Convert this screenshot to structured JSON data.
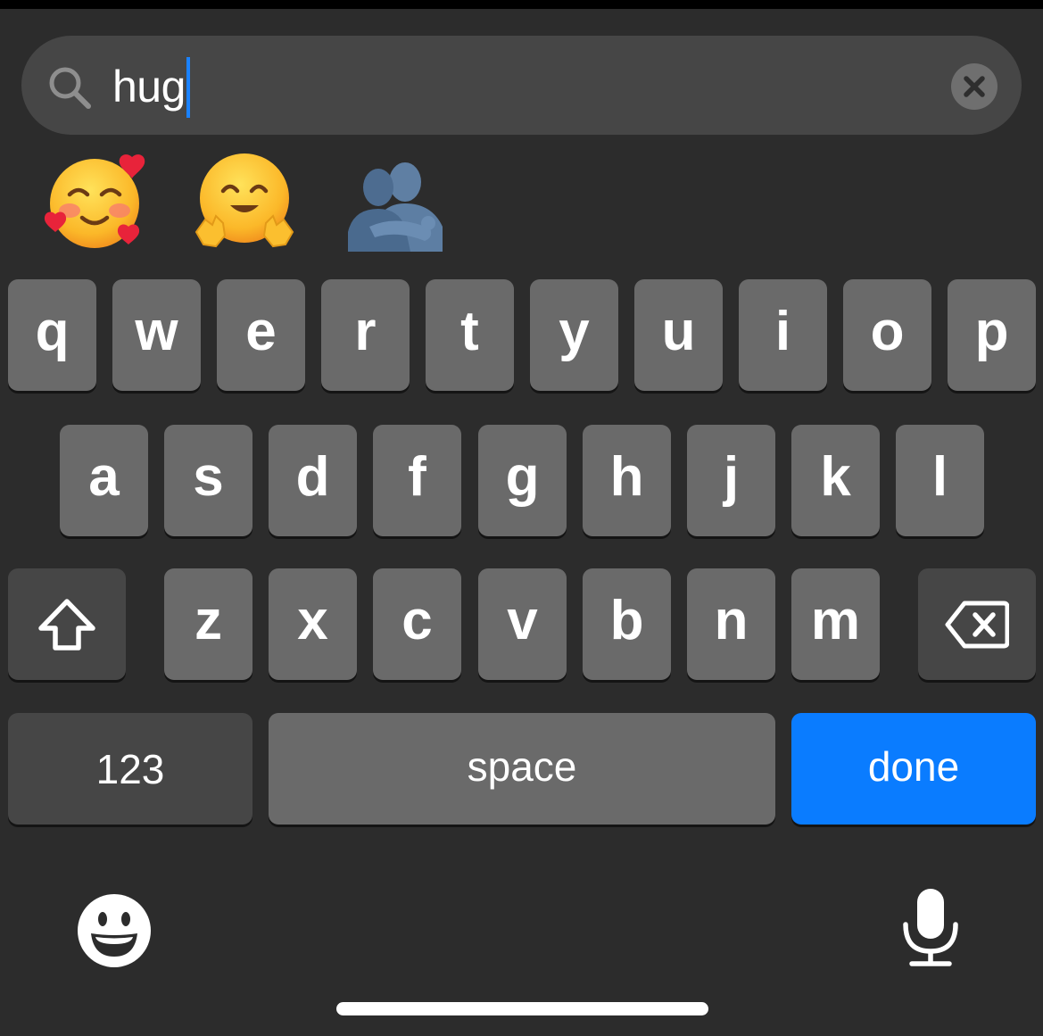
{
  "search": {
    "query": "hug",
    "icon": "magnifying-glass-icon",
    "clear_icon": "clear-x-icon"
  },
  "emoji_results": [
    {
      "name": "smiling-face-with-hearts-emoji",
      "glyph": "🥰"
    },
    {
      "name": "hugging-face-emoji",
      "glyph": "🤗"
    },
    {
      "name": "people-hugging-emoji",
      "glyph": "🫂"
    }
  ],
  "keyboard": {
    "row1": [
      "q",
      "w",
      "e",
      "r",
      "t",
      "y",
      "u",
      "i",
      "o",
      "p"
    ],
    "row2": [
      "a",
      "s",
      "d",
      "f",
      "g",
      "h",
      "j",
      "k",
      "l"
    ],
    "row3": [
      "z",
      "x",
      "c",
      "v",
      "b",
      "n",
      "m"
    ],
    "shift_icon": "shift-arrow-icon",
    "delete_icon": "backspace-icon",
    "numbers_label": "123",
    "space_label": "space",
    "done_label": "done",
    "emoji_key_icon": "emoji-face-icon",
    "dictation_icon": "microphone-icon"
  },
  "colors": {
    "background": "#2c2c2c",
    "key": "#6a6a6a",
    "dark_key": "#464646",
    "accent": "#0a7cff",
    "caret": "#1a82ff"
  }
}
